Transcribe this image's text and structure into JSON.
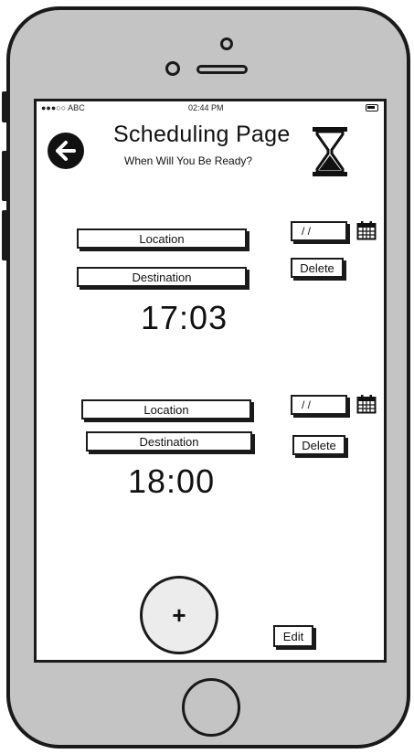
{
  "status_bar": {
    "carrier": "●●●○○ ABC",
    "time": "02:44 PM"
  },
  "header": {
    "title": "Scheduling Page",
    "subtitle": "When Will You Be Ready?"
  },
  "schedules": [
    {
      "location_label": "Location",
      "destination_label": "Destination",
      "time": "17:03",
      "date_placeholder": "/ /",
      "delete_label": "Delete"
    },
    {
      "location_label": "Location",
      "destination_label": "Destination",
      "time": "18:00",
      "date_placeholder": "/ /",
      "delete_label": "Delete"
    }
  ],
  "footer": {
    "add_label": "+",
    "edit_label": "Edit"
  },
  "icons": {
    "back": "back-arrow-icon",
    "hourglass": "hourglass-icon",
    "calendar": "calendar-icon",
    "battery": "battery-icon"
  },
  "colors": {
    "device": "#c4c4c4",
    "ink": "#1a1a1a",
    "screen": "#ffffff"
  }
}
